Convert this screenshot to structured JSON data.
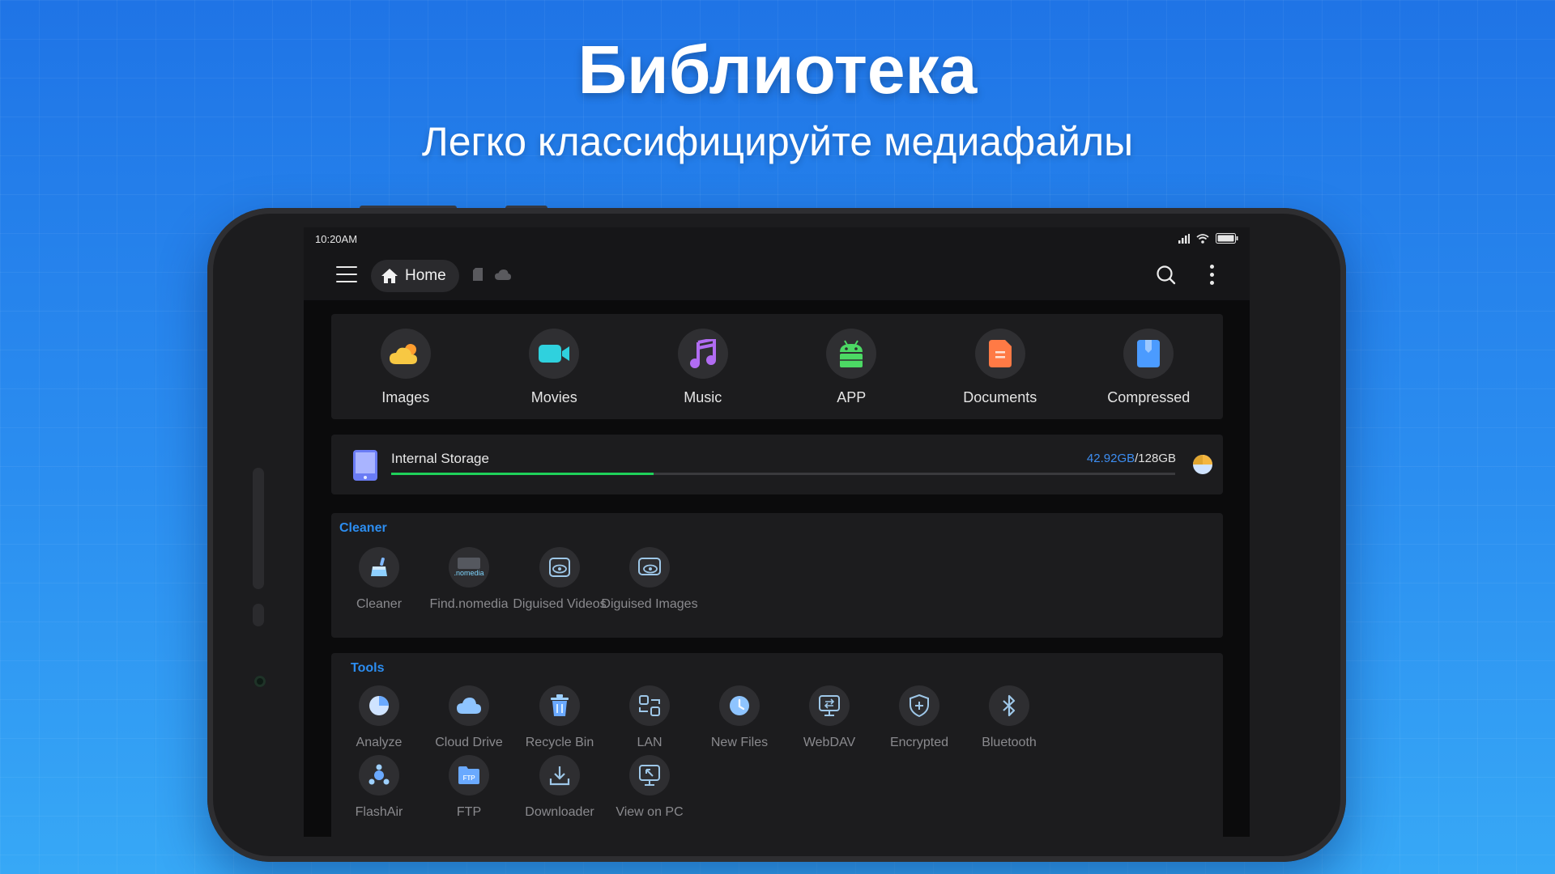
{
  "hero": {
    "title": "Библиотека",
    "subtitle": "Легко классифицируйте медиафайлы"
  },
  "status_bar": {
    "time": "10:20AM",
    "icons": [
      "signal-icon",
      "wifi-icon",
      "battery-icon"
    ]
  },
  "header": {
    "home_label": "Home",
    "icons": [
      "menu-icon",
      "home-icon",
      "sd-card-icon",
      "cloud-icon",
      "search-icon",
      "more-vertical-icon"
    ]
  },
  "categories": [
    {
      "label": "Images",
      "icon": "images-icon",
      "color": "#f7c843"
    },
    {
      "label": "Movies",
      "icon": "movies-icon",
      "color": "#2fd1de"
    },
    {
      "label": "Music",
      "icon": "music-icon",
      "color": "#b16cf2"
    },
    {
      "label": "APP",
      "icon": "android-icon",
      "color": "#4cd964"
    },
    {
      "label": "Documents",
      "icon": "documents-icon",
      "color": "#ff7a45"
    },
    {
      "label": "Compressed",
      "icon": "compressed-icon",
      "color": "#4b9bff"
    }
  ],
  "storage": {
    "name": "Internal Storage",
    "used": "42.92GB",
    "total": "/128GB",
    "used_fraction": 0.335,
    "bar_color": "#1fd15a"
  },
  "cleaner": {
    "title": "Cleaner",
    "items": [
      {
        "label": "Cleaner",
        "icon": "broom-icon"
      },
      {
        "label": "Find.nomedia",
        "icon": "nomedia-icon"
      },
      {
        "label": "Diguised Videos",
        "icon": "disguised-videos-icon"
      },
      {
        "label": "Diguised Images",
        "icon": "disguised-images-icon"
      }
    ]
  },
  "tools": {
    "title": "Tools",
    "items": [
      {
        "label": "Analyze",
        "icon": "analyze-icon"
      },
      {
        "label": "Cloud Drive",
        "icon": "cloud-drive-icon"
      },
      {
        "label": "Recycle Bin",
        "icon": "recycle-bin-icon"
      },
      {
        "label": "LAN",
        "icon": "lan-icon"
      },
      {
        "label": "New Files",
        "icon": "new-files-icon"
      },
      {
        "label": "WebDAV",
        "icon": "webdav-icon"
      },
      {
        "label": "Encrypted",
        "icon": "encrypted-icon"
      },
      {
        "label": "Bluetooth",
        "icon": "bluetooth-icon"
      },
      {
        "label": "FlashAir",
        "icon": "flashair-icon"
      },
      {
        "label": "FTP",
        "icon": "ftp-icon"
      },
      {
        "label": "Downloader",
        "icon": "downloader-icon"
      },
      {
        "label": "View on PC",
        "icon": "view-on-pc-icon"
      }
    ]
  },
  "theme": {
    "accent": "#2c8df0",
    "used_text": "#3d8ef2"
  }
}
